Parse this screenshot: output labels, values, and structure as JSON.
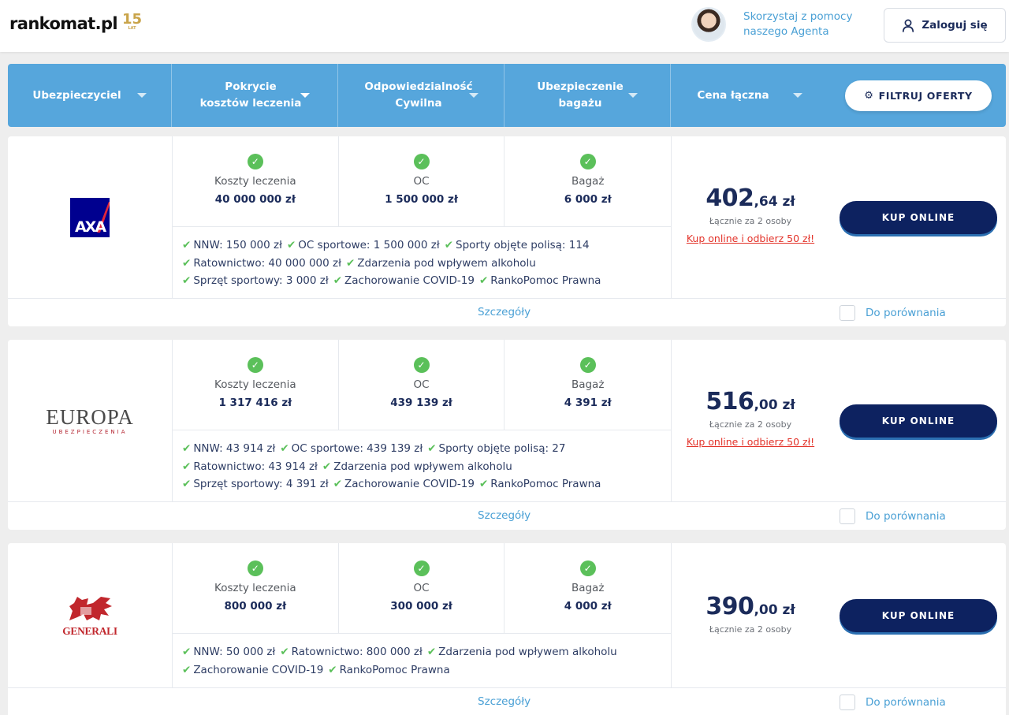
{
  "header": {
    "logo_text": "rankomat.pl",
    "logo_badge": "15",
    "logo_badge_small": "LAT",
    "agent_text": "Skorzystaj z pomocy naszego Agenta",
    "login_label": "Zaloguj się"
  },
  "filters": {
    "insurer": "Ubezpieczyciel",
    "medical": "Pokrycie kosztów leczenia",
    "liability": "Odpowiedzialność Cywilna",
    "luggage": "Ubezpieczenie bagażu",
    "price": "Cena łączna",
    "filter_button": "FILTRUJ OFERTY"
  },
  "labels": {
    "coverage_medical": "Koszty leczenia",
    "coverage_oc": "OC",
    "coverage_luggage": "Bagaż",
    "details": "Szczegóły",
    "compare": "Do porównania",
    "buy": "KUP ONLINE",
    "people": "Łącznie za 2 osoby",
    "promo": "Kup online i odbierz 50 zł!"
  },
  "offers": [
    {
      "insurer": "AXA",
      "medical": "40 000 000 zł",
      "oc": "1 500 000 zł",
      "luggage": "6 000 zł",
      "price_int": "402",
      "price_dec": ",64 zł",
      "features": [
        "NNW: 150 000 zł",
        "OC sportowe: 1 500 000 zł",
        "Sporty objęte polisą: 114",
        "Ratownictwo: 40 000 000 zł",
        "Zdarzenia pod wpływem alkoholu",
        "Sprzęt sportowy: 3 000 zł",
        "Zachorowanie COVID-19",
        "RankoPomoc Prawna"
      ]
    },
    {
      "insurer": "EUROPA",
      "insurer_sub": "UBEZPIECZENIA",
      "medical": "1 317 416 zł",
      "oc": "439 139 zł",
      "luggage": "4 391 zł",
      "price_int": "516",
      "price_dec": ",00 zł",
      "features": [
        "NNW: 43 914 zł",
        "OC sportowe: 439 139 zł",
        "Sporty objęte polisą: 27",
        "Ratownictwo: 43 914 zł",
        "Zdarzenia pod wpływem alkoholu",
        "Sprzęt sportowy: 4 391 zł",
        "Zachorowanie COVID-19",
        "RankoPomoc Prawna"
      ]
    },
    {
      "insurer": "GENERALI",
      "medical": "800 000 zł",
      "oc": "300 000 zł",
      "luggage": "4 000 zł",
      "price_int": "390",
      "price_dec": ",00 zł",
      "features": [
        "NNW: 50 000 zł",
        "Ratownictwo: 800 000 zł",
        "Zdarzenia pod wpływem alkoholu",
        "Zachorowanie COVID-19",
        "RankoPomoc Prawna"
      ]
    }
  ],
  "colors": {
    "brand_blue": "#56a6dc",
    "navy": "#0d2260",
    "check_green": "#5bc05a",
    "promo_red": "#e3332a",
    "axa_blue": "#00008f",
    "axa_red": "#e4253a",
    "europa_red": "#b3232f",
    "generali_red": "#c1272d"
  }
}
